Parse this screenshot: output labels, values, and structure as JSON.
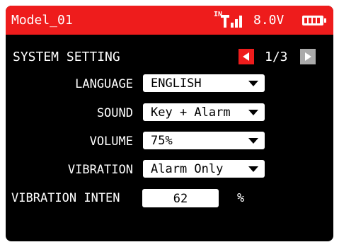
{
  "titlebar": {
    "model_name": "Model_01",
    "signal_prefix": "IN",
    "signal_icon": "signal-bars-icon",
    "voltage": "8.0V",
    "battery_icon": "battery-full-icon",
    "background_color": "#ee1c1c"
  },
  "section": {
    "title": "SYSTEM SETTING"
  },
  "pagination": {
    "indicator": "1/3",
    "prev_icon": "arrow-left-icon",
    "next_icon": "arrow-right-icon"
  },
  "settings": [
    {
      "label": "LANGUAGE",
      "value": "ENGLISH"
    },
    {
      "label": "SOUND",
      "value": "Key + Alarm"
    },
    {
      "label": "VOLUME",
      "value": "75%"
    },
    {
      "label": "VIBRATION",
      "value": "Alarm Only"
    }
  ],
  "vibration_intensity": {
    "label": "VIBRATION INTEN",
    "value": "62",
    "unit": "%"
  }
}
